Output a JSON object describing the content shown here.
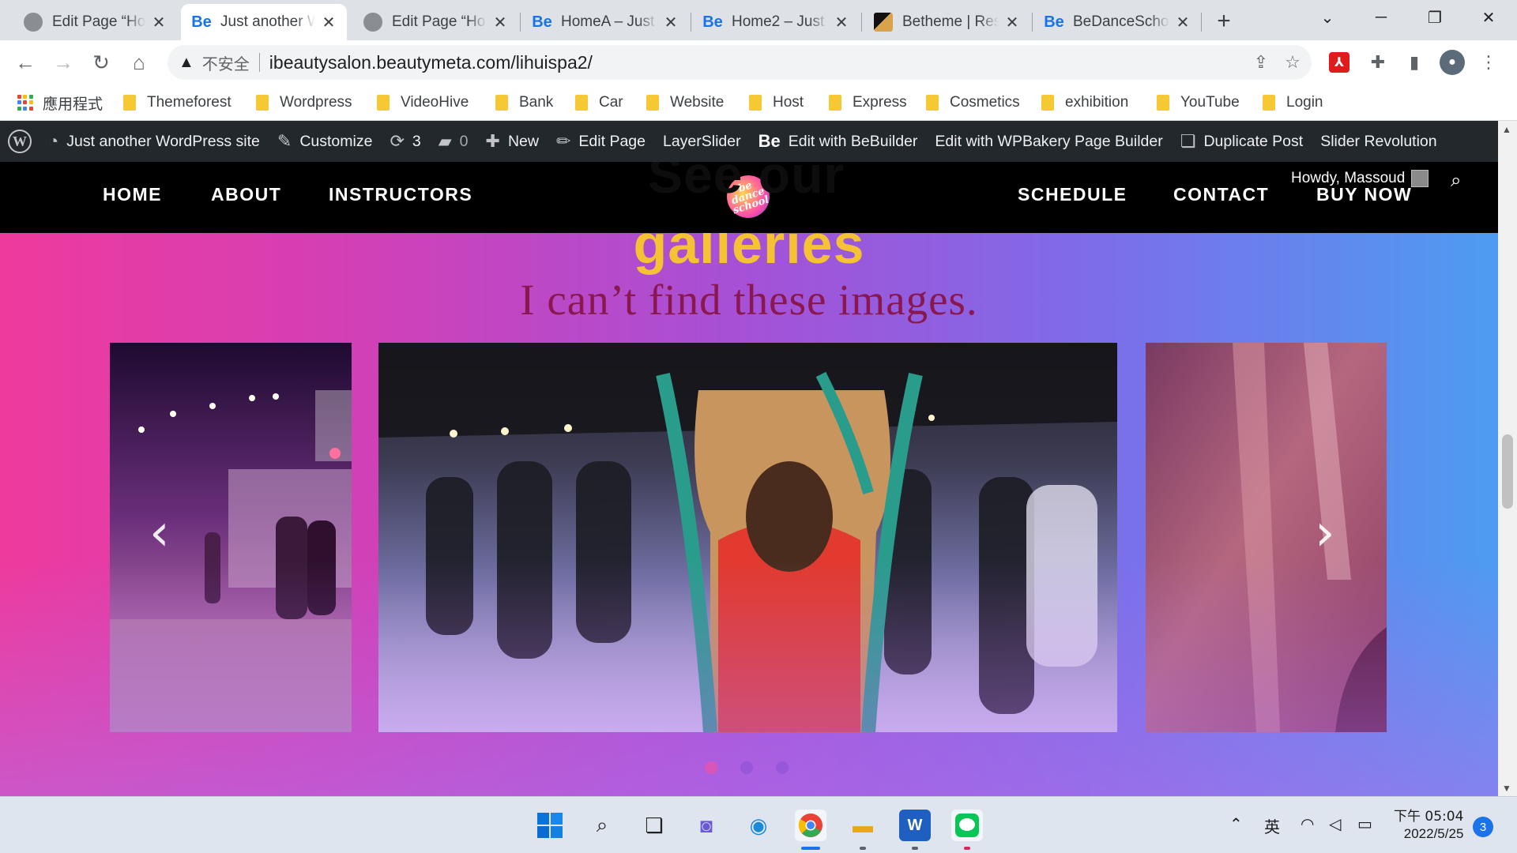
{
  "browser": {
    "tabs": [
      {
        "title": "Edit Page “Ho",
        "favicon": "globe"
      },
      {
        "title": "Just another W",
        "favicon": "Be",
        "active": true
      },
      {
        "title": "Edit Page “Ho",
        "favicon": "globe"
      },
      {
        "title": "HomeA – Just",
        "favicon": "Be"
      },
      {
        "title": "Home2 – Just",
        "favicon": "Be"
      },
      {
        "title": "Betheme | Res",
        "favicon": "betheme"
      },
      {
        "title": "BeDanceScho",
        "favicon": "Be"
      }
    ],
    "insecure_label": "不安全",
    "url": "ibeautysalon.beautymeta.com/lihuispa2/",
    "bookmarks": [
      "應用程式",
      "Themeforest",
      "Wordpress",
      "VideoHive",
      "Bank",
      "Car",
      "Website",
      "Host",
      "Express",
      "Cosmetics",
      "exhibition",
      "YouTube",
      "Login"
    ]
  },
  "wp_admin_bar": {
    "site_name": "Just another WordPress site",
    "customize": "Customize",
    "updates_count": "3",
    "comments_count": "0",
    "new": "New",
    "edit_page": "Edit Page",
    "layerslider": "LayerSlider",
    "bebuilder_icon": "Be",
    "edit_bebuilder": "Edit with BeBuilder",
    "edit_wpbakery": "Edit with WPBakery Page Builder",
    "duplicate_post": "Duplicate Post",
    "slider_revolution": "Slider Revolution"
  },
  "site": {
    "nav_left": [
      "HOME",
      "ABOUT",
      "INSTRUCTORS"
    ],
    "nav_right": [
      "SCHEDULE",
      "CONTACT",
      "BUY NOW"
    ],
    "logo_text": "be dance school",
    "howdy": "Howdy, Massoud",
    "heading_overlap": "See our",
    "heading": "galleries",
    "subheading": "I can’t find these images.",
    "carousel": {
      "dot_count": 3,
      "active_dot": 0
    }
  },
  "taskbar": {
    "ime": "英",
    "time": "下午 05:04",
    "date": "2022/5/25",
    "notifications": "3"
  },
  "colors": {
    "heading": "#f5c233",
    "subheading": "#8a1850",
    "wp_bar": "#23282d",
    "dot_active": "#ff3f88"
  }
}
